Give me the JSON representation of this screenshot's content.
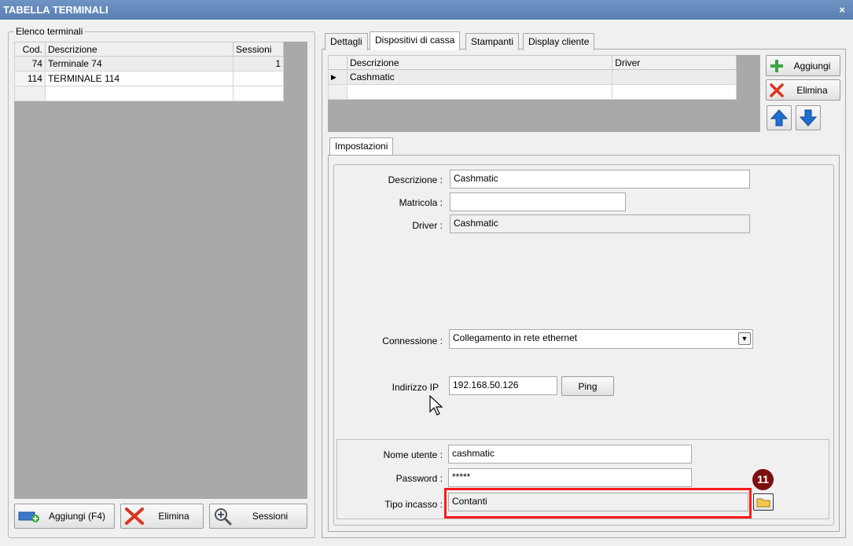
{
  "window": {
    "title": "TABELLA TERMINALI",
    "close_glyph": "×"
  },
  "terminals": {
    "legend": "Elenco terminali",
    "columns": [
      "Cod.",
      "Descrizione",
      "Sessioni"
    ],
    "rows": [
      {
        "code": "74",
        "description": "Terminale 74",
        "sessions": "1"
      },
      {
        "code": "114",
        "description": "TERMINALE 114",
        "sessions": ""
      }
    ],
    "buttons": {
      "add": "Aggiungi (F4)",
      "delete": "Elimina",
      "sessions": "Sessioni"
    }
  },
  "tabs": [
    "Dettagli",
    "Dispositivi di cassa",
    "Stampanti",
    "Display cliente"
  ],
  "devices": {
    "columns": [
      "Descrizione",
      "Driver"
    ],
    "rows": [
      {
        "description": "Cashmatic",
        "driver": ""
      }
    ],
    "buttons": {
      "add": "Aggiungi",
      "delete": "Elimina"
    }
  },
  "settings": {
    "tab": "Impostazioni",
    "fields": {
      "descrizione_label": "Descrizione :",
      "descrizione_value": "Cashmatic",
      "matricola_label": "Matricola :",
      "matricola_value": "",
      "driver_label": "Driver :",
      "driver_value": "Cashmatic",
      "connessione_label": "Connessione :",
      "connessione_value": "Collegamento in rete ethernet",
      "ip_label": "Indirizzo IP",
      "ip_value": "192.168.50.126",
      "ping_button": "Ping",
      "nome_utente_label": "Nome utente :",
      "nome_utente_value": "cashmatic",
      "password_label": "Password :",
      "password_value": "*****",
      "tipo_incasso_label": "Tipo incasso :",
      "tipo_incasso_value": "Contanti"
    }
  },
  "annotation": {
    "badge": "11",
    "color": "#ff1a1a"
  },
  "colors": {
    "titlebar": "#6485b9",
    "grid_bg": "#a9a9a9",
    "add_green": "#3aa640",
    "delete_red": "#d9341f",
    "arrow_blue": "#1e6fd1"
  }
}
